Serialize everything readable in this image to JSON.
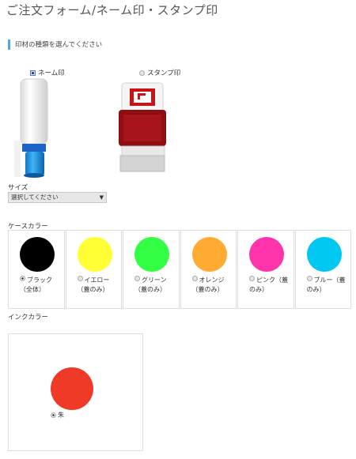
{
  "page": {
    "title": "ご注文フォーム/ネーム印・スタンプ印"
  },
  "section": {
    "label": "印材の種類を選んでください"
  },
  "types": [
    {
      "label": "ネーム印",
      "selected": true
    },
    {
      "label": "スタンプ印",
      "selected": false
    }
  ],
  "size": {
    "label": "サイズ",
    "select_value": "選択してください"
  },
  "case_color": {
    "label": "ケースカラー",
    "options": [
      {
        "label": "ブラック（全体）",
        "color": "#000000",
        "selected": true
      },
      {
        "label": "イエロー（蓋のみ）",
        "color": "#ffff33",
        "selected": false
      },
      {
        "label": "グリーン（蓋のみ）",
        "color": "#33ff44",
        "selected": false
      },
      {
        "label": "オレンジ（蓋のみ）",
        "color": "#ffaa33",
        "selected": false
      },
      {
        "label": "ピンク（蓋のみ）",
        "color": "#ff33aa",
        "selected": false
      },
      {
        "label": "ブルー（蓋のみ）",
        "color": "#00c8f0",
        "selected": false
      }
    ]
  },
  "ink_color": {
    "label": "インクカラー",
    "options": [
      {
        "label": "朱",
        "color": "#f03a28",
        "selected": true
      }
    ]
  }
}
